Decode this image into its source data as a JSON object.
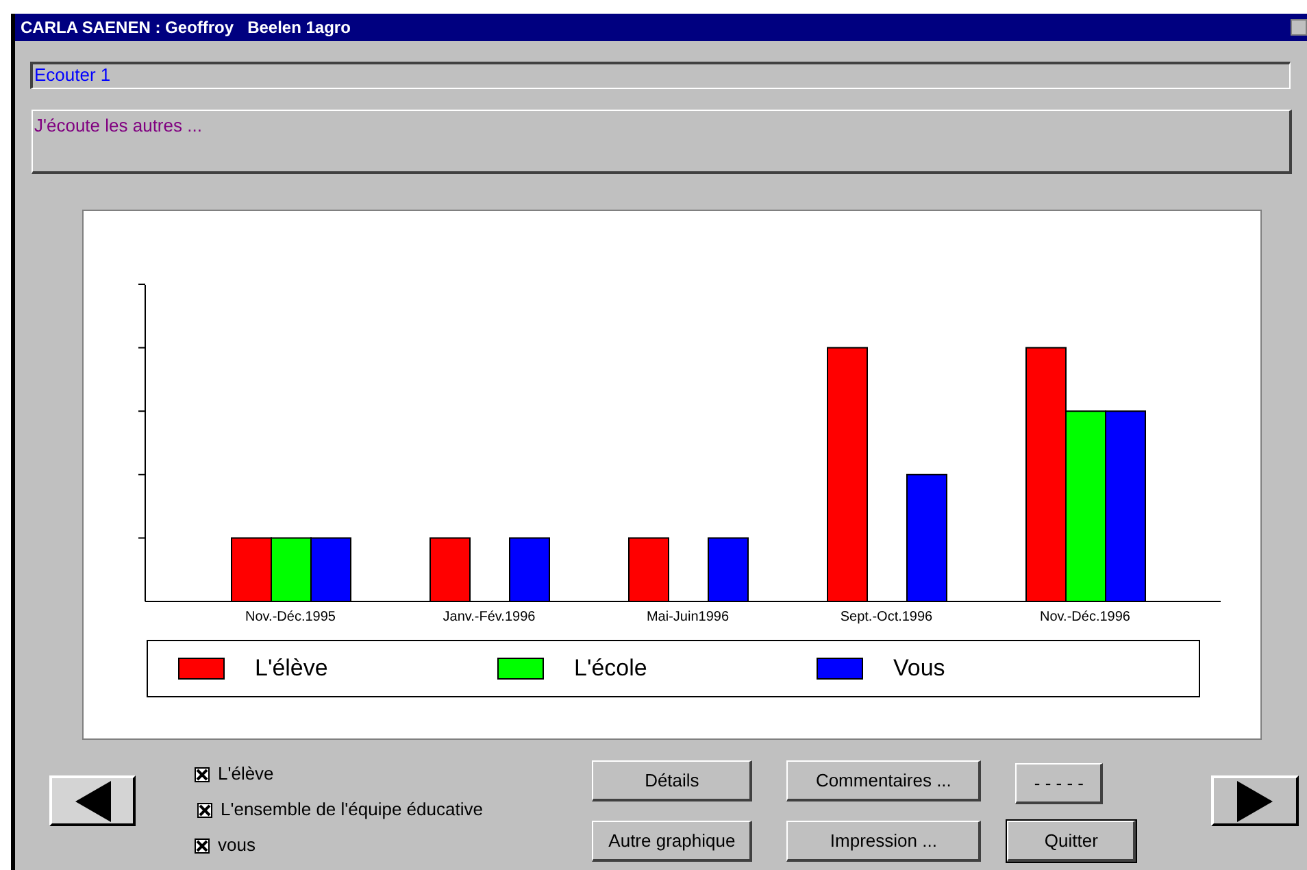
{
  "window": {
    "title": "CARLA SAENEN : Geoffroy   Beelen 1agro"
  },
  "heading_field": {
    "value": "Ecouter 1"
  },
  "text_area": {
    "value": "J'écoute les autres ..."
  },
  "chart": {
    "categories": [
      "Nov.-Déc.1995",
      "Janv.-Fév.1996",
      "Mai-Juin1996",
      "Sept.-Oct.1996",
      "Nov.-Déc.1996"
    ],
    "legend": [
      {
        "label": "L'élève",
        "color": "#ff0000"
      },
      {
        "label": "L'école",
        "color": "#00ff00"
      },
      {
        "label": "Vous",
        "color": "#0000ff"
      }
    ]
  },
  "checkboxes": [
    {
      "label": "L'élève",
      "checked": true
    },
    {
      "label": "L'ensemble de l'équipe éducative",
      "checked": true
    },
    {
      "label": "vous",
      "checked": true
    }
  ],
  "buttons": [
    {
      "label": "Détails",
      "default": false
    },
    {
      "label": "Commentaires ...",
      "default": false
    },
    {
      "label": "- - - - -",
      "default": false
    },
    {
      "label": "Autre graphique",
      "default": false
    },
    {
      "label": "Impression ...",
      "default": false
    },
    {
      "label": "Quitter",
      "default": true
    }
  ]
}
